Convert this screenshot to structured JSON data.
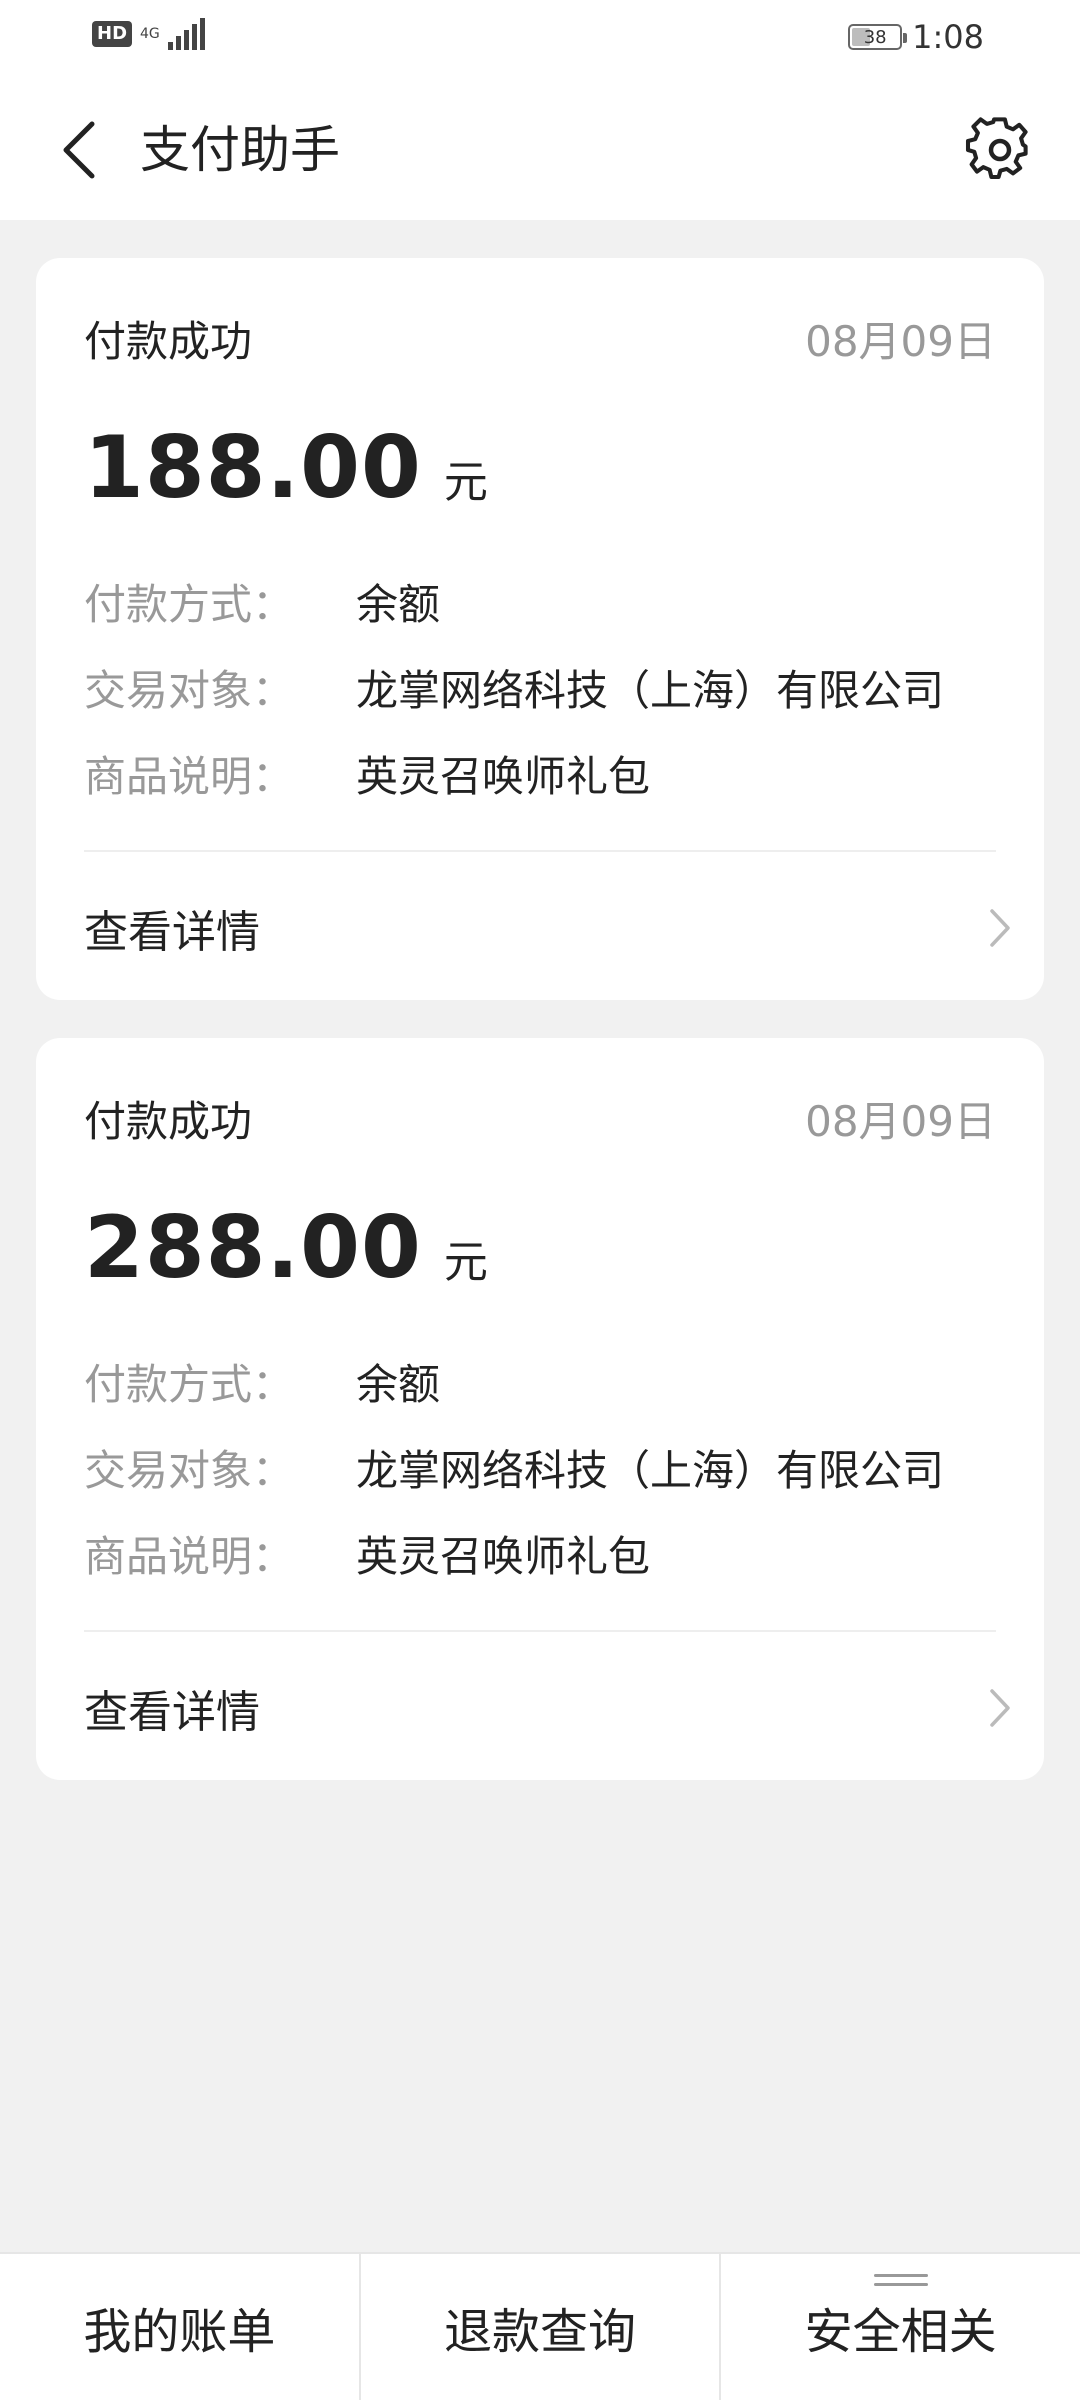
{
  "status_bar": {
    "hd": "HD",
    "network": "4G",
    "battery": "38",
    "battery_level": 0.38,
    "time": "1:08"
  },
  "header": {
    "title": "支付助手",
    "back_icon": "chevron-left-icon",
    "settings_icon": "gear-icon"
  },
  "cards": [
    {
      "status": "付款成功",
      "date": "08月09日",
      "amount": "188.00",
      "unit": "元",
      "rows": [
        {
          "label": "付款方式：",
          "value": "余额"
        },
        {
          "label": "交易对象：",
          "value": "龙掌网络科技（上海）有限公司"
        },
        {
          "label": "商品说明：",
          "value": "英灵召唤师礼包"
        }
      ],
      "detail_label": "查看详情"
    },
    {
      "status": "付款成功",
      "date": "08月09日",
      "amount": "288.00",
      "unit": "元",
      "rows": [
        {
          "label": "付款方式：",
          "value": "余额"
        },
        {
          "label": "交易对象：",
          "value": "龙掌网络科技（上海）有限公司"
        },
        {
          "label": "商品说明：",
          "value": "英灵召唤师礼包"
        }
      ],
      "detail_label": "查看详情"
    }
  ],
  "bottom_nav": [
    {
      "label": "我的账单"
    },
    {
      "label": "退款查询"
    },
    {
      "label": "安全相关"
    }
  ],
  "colors": {
    "background": "#f1f1f1",
    "card": "#ffffff",
    "muted_text": "#999999",
    "text": "#222222"
  }
}
